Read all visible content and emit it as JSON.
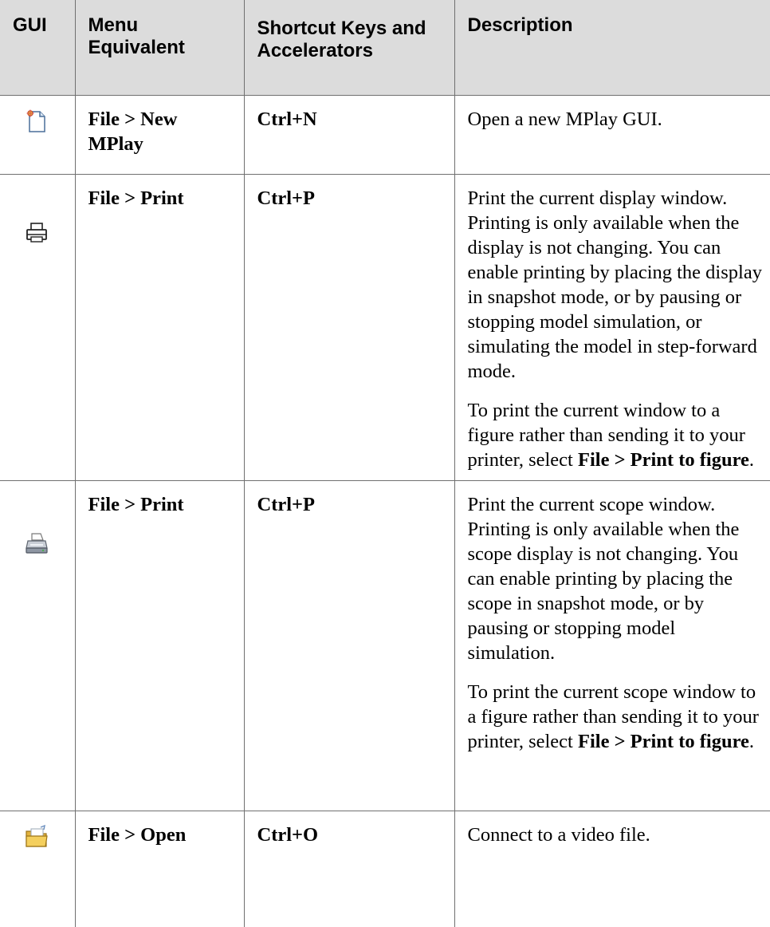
{
  "headers": {
    "gui": "GUI",
    "menu": "Menu Equivalent",
    "shortcut": "Shortcut Keys and Accelerators",
    "description": "Description"
  },
  "rows": [
    {
      "icon": "new-document-icon",
      "menu": "File > New MPlay",
      "shortcut": "Ctrl+N",
      "desc": [
        "Open a new MPlay GUI."
      ]
    },
    {
      "icon": "print-icon",
      "menu": "File > Print",
      "shortcut": "Ctrl+P",
      "desc": [
        "Print the current display window.  Printing is only available when the display is not changing. You can enable printing by placing the display in snapshot mode, or by pausing or stopping model simulation, or simulating the model in step-forward mode.",
        {
          "pre": "To print the current window to a figure rather than sending it to your printer, select ",
          "bold": "File > Print to figure",
          "post": "."
        }
      ]
    },
    {
      "icon": "printer-icon",
      "menu": "File > Print",
      "shortcut": "Ctrl+P",
      "desc": [
        "Print the current scope window.  Printing is only available when the scope display is not changing. You can enable printing by placing the scope in snapshot mode, or by pausing or stopping model simulation.",
        {
          "pre": "To print the current scope window to a figure rather than sending it to your printer, select ",
          "bold": "File > Print to figure",
          "post": "."
        }
      ]
    },
    {
      "icon": "open-folder-icon",
      "menu": "File > Open",
      "shortcut": "Ctrl+O",
      "desc": [
        "Connect to a video file."
      ]
    }
  ],
  "colors": {
    "header_bg": "#dcdcdc",
    "rule": "#707070",
    "text": "#000000"
  }
}
